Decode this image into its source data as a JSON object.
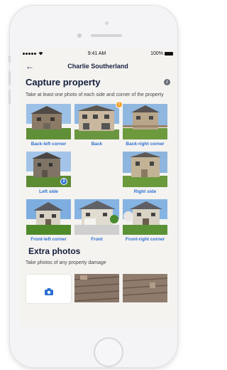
{
  "status_bar": {
    "signal": "•••••",
    "time": "9:41 AM",
    "battery": "100%"
  },
  "navbar": {
    "back_icon": "back-arrow-icon",
    "title": "Charlie Southerland"
  },
  "capture": {
    "title": "Capture property",
    "info_icon": "i",
    "description": "Take at least one photo of each side and corner of the property",
    "tiles": [
      {
        "label": "Back-left corner"
      },
      {
        "label": "Back",
        "badge": "!"
      },
      {
        "label": "Back-right corner"
      },
      {
        "label": "Left side",
        "badge": "2"
      },
      {
        "label": "Right side"
      },
      {
        "label": "Front-left corner"
      },
      {
        "label": "Front"
      },
      {
        "label": "Front-right corner"
      }
    ]
  },
  "extra": {
    "title": "Extra photos",
    "description": "Take photos of any property damage",
    "add_icon": "camera-icon"
  },
  "colors": {
    "accent": "#2d6fd2",
    "warning": "#f2a22c",
    "heading": "#141e3c"
  }
}
